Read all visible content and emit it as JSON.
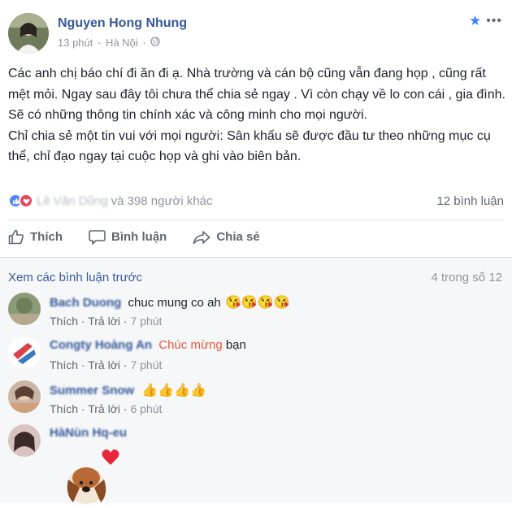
{
  "post": {
    "author": "Nguyen Hong Nhung",
    "time": "13 phút",
    "location": "Hà Nội",
    "paragraphs": [
      "Các anh chị báo chí đi ăn đi ạ. Nhà trường và cán bộ cũng vẫn đang họp , cũng rất mệt mỏi. Ngay sau đây tôi chưa thể chia sẻ ngay . Vì còn chạy về lo con cái , gia đình. Sẽ có những thông tin chính xác và công minh cho mọi người.",
      "Chỉ chia sẻ một tin vui với mọi người: Sân khấu sẽ được đầu tư theo những mục cụ thể, chỉ đạo ngay tại cuộc họp và ghi vào biên bản."
    ],
    "icons": {
      "favorite": "star-icon",
      "more": "more-options-icon",
      "audience": "globe-icon"
    }
  },
  "stats": {
    "reactor_name": "Lê Văn Dũng",
    "reactors_suffix": "và 398 người khác",
    "comment_count": "12 bình luận"
  },
  "actions": {
    "like": "Thích",
    "comment": "Bình luận",
    "share": "Chia sẻ"
  },
  "comments_section": {
    "see_previous": "Xem các bình luận trước",
    "count": "4 trong số 12",
    "like_label": "Thích",
    "reply_label": "Trả lời",
    "items": [
      {
        "author": "Bach Duong",
        "text": "chuc mung co ah",
        "highlight": "",
        "trailing": "",
        "emoji": "😘😘😘😘",
        "time": "7 phút"
      },
      {
        "author": "Congty Hoàng An",
        "text": "",
        "highlight": "Chúc mừng",
        "trailing": "bạn",
        "emoji": "",
        "time": "7 phút"
      },
      {
        "author": "Summer Snow",
        "text": "",
        "highlight": "",
        "trailing": "",
        "emoji": "👍👍👍👍",
        "time": "6 phút"
      },
      {
        "author": "HàNùn Hq-eu",
        "text": "",
        "highlight": "",
        "trailing": "",
        "emoji": "",
        "time": ""
      }
    ]
  },
  "colors": {
    "link_blue": "#365899",
    "muted": "#90949c",
    "like_blue": "#4e87f5",
    "love_red": "#f0425d",
    "highlight_red": "#e9573f"
  }
}
